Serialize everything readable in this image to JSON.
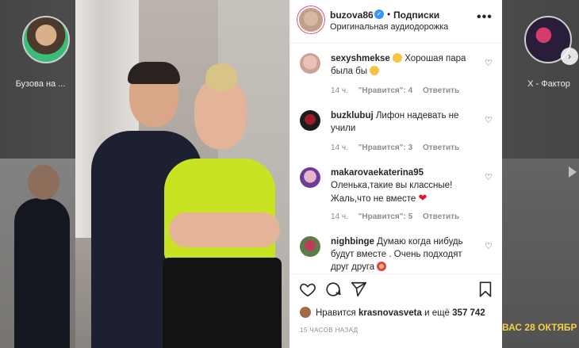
{
  "stories": {
    "left_name": "Бузова на ...",
    "right_name": "X - Фактор"
  },
  "side": {
    "right_caption": "ВАС 28 ОКТЯБР"
  },
  "post": {
    "username": "buzova86",
    "follow_label": "Подписки",
    "audio_label": "Оригинальная аудиодорожка",
    "more_label": "•••"
  },
  "comments": [
    {
      "user": "sexyshmekse",
      "text": "Хорошая пара была бы",
      "time": "14 ч.",
      "likes": "\"Нравится\": 4",
      "reply": "Ответить"
    },
    {
      "user": "buzklubuj",
      "text": "Лифон надевать не учили",
      "time": "14 ч.",
      "likes": "\"Нравится\": 3",
      "reply": "Ответить"
    },
    {
      "user": "makarovaekaterina95",
      "text": "Оленька,такие вы классные! Жаль,что не вместе",
      "time": "14 ч.",
      "likes": "\"Нравится\": 5",
      "reply": "Ответить"
    },
    {
      "user": "nighbinge",
      "text": "Думаю когда нибудь будут вместе . Очень подходят друг друга",
      "time": "",
      "likes": "",
      "reply": ""
    }
  ],
  "likes_row": {
    "prefix": "Нравится",
    "liker": "krasnovasveta",
    "suffix": "и ещё",
    "count": "357 742"
  },
  "time_ago": "15 ЧАСОВ НАЗАД",
  "colors": {
    "verified": "#3897f0",
    "muted": "#8e8e8e",
    "text": "#262626"
  }
}
